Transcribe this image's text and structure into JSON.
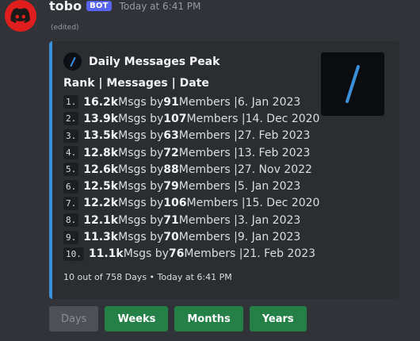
{
  "message": {
    "username": "tobo",
    "bot_tag": "BOT",
    "timestamp": "Today at 6:41 PM",
    "edited": "(edited)"
  },
  "embed": {
    "accent_color": "#3b8fd9",
    "author": "Daily Messages Peak",
    "title": "Rank | Messages | Date",
    "rows": [
      {
        "rank": "1.",
        "msgs": "16.2k",
        "members": "91",
        "date": "6. Jan 2023"
      },
      {
        "rank": "2.",
        "msgs": "13.9k",
        "members": "107",
        "date": "14. Dec 2020"
      },
      {
        "rank": "3.",
        "msgs": "13.5k",
        "members": "63",
        "date": "27. Feb 2023"
      },
      {
        "rank": "4.",
        "msgs": "12.8k",
        "members": "72",
        "date": "13. Feb 2023"
      },
      {
        "rank": "5.",
        "msgs": "12.6k",
        "members": "88",
        "date": "27. Nov 2022"
      },
      {
        "rank": "6.",
        "msgs": "12.5k",
        "members": "79",
        "date": "5. Jan 2023"
      },
      {
        "rank": "7.",
        "msgs": "12.2k",
        "members": "106",
        "date": "15. Dec 2020"
      },
      {
        "rank": "8.",
        "msgs": "12.1k",
        "members": "71",
        "date": "3. Jan 2023"
      },
      {
        "rank": "9.",
        "msgs": "11.3k",
        "members": "70",
        "date": "9. Jan 2023"
      },
      {
        "rank": "10.",
        "msgs": "11.1k",
        "members": "76",
        "date": "21. Feb 2023"
      }
    ],
    "word_msgs_by": " Msgs by ",
    "word_members": " Members | ",
    "footer": "10 out of 758 Days • Today at 6:41 PM"
  },
  "buttons": [
    {
      "label": "Days",
      "disabled": true
    },
    {
      "label": "Weeks",
      "disabled": false
    },
    {
      "label": "Months",
      "disabled": false
    },
    {
      "label": "Years",
      "disabled": false
    }
  ],
  "icons": {
    "avatar": "discord-logo-icon",
    "author": "slash-icon",
    "thumbnail": "slash-icon"
  },
  "colors": {
    "background": "#313338",
    "embed_background": "#2b2d31",
    "bot_tag": "#5865f2",
    "button_primary": "#248046",
    "button_disabled": "#4e5058",
    "avatar": "#e01e1e"
  }
}
